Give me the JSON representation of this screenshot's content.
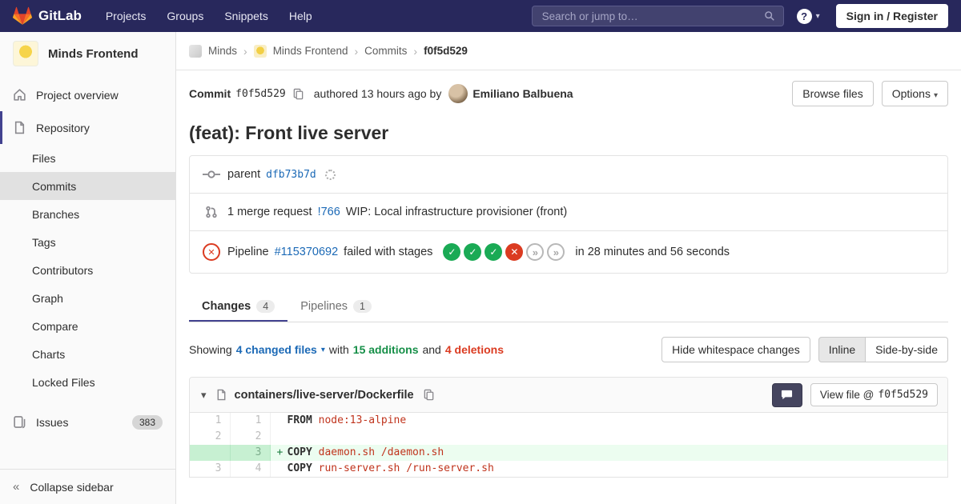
{
  "navbar": {
    "brand": "GitLab",
    "menu": [
      "Projects",
      "Groups",
      "Snippets",
      "Help"
    ],
    "search_placeholder": "Search or jump to…",
    "sign_in_label": "Sign in / Register",
    "help_label": "?"
  },
  "icons": {
    "caret_down": "▾",
    "chevron_right": "›",
    "collapse": "«",
    "check": "✓",
    "cross": "✕",
    "skipped": "»"
  },
  "sidebar": {
    "project_name": "Minds Frontend",
    "overview_label": "Project overview",
    "repository_label": "Repository",
    "repo_items": [
      "Files",
      "Commits",
      "Branches",
      "Tags",
      "Contributors",
      "Graph",
      "Compare",
      "Charts",
      "Locked Files"
    ],
    "issues_label": "Issues",
    "issues_count": "383",
    "collapse_label": "Collapse sidebar"
  },
  "breadcrumb": {
    "minds": "Minds",
    "minds_frontend": "Minds Frontend",
    "commits": "Commits",
    "sha": "f0f5d529"
  },
  "commit": {
    "label": "Commit",
    "sha": "f0f5d529",
    "authored_text": "authored 13 hours ago by",
    "author": "Emiliano Balbuena",
    "browse_files_label": "Browse files",
    "options_label": "Options",
    "title": "(feat): Front live server"
  },
  "parent_row": {
    "label": "parent",
    "sha": "dfb73b7d"
  },
  "merge_request_row": {
    "prefix": "1 merge request",
    "link": "!766",
    "title": "WIP: Local infrastructure provisioner (front)"
  },
  "pipeline_row": {
    "prefix": "Pipeline",
    "link": "#115370692",
    "middle": "failed with stages",
    "suffix": "in 28 minutes and 56 seconds",
    "stages": [
      "passed",
      "passed",
      "passed",
      "failed",
      "skipped",
      "skipped"
    ]
  },
  "tabs": {
    "changes_label": "Changes",
    "changes_count": "4",
    "pipelines_label": "Pipelines",
    "pipelines_count": "1"
  },
  "summary": {
    "showing": "Showing",
    "changed_files": "4 changed files",
    "with_text": "with",
    "additions": "15 additions",
    "and_text": "and",
    "deletions": "4 deletions",
    "hide_whitespace_label": "Hide whitespace changes",
    "inline_label": "Inline",
    "side_by_side_label": "Side-by-side"
  },
  "diff_file": {
    "path": "containers/live-server/Dockerfile",
    "view_file_label": "View file @",
    "view_file_sha": "f0f5d529",
    "rows": [
      {
        "old": "1",
        "new": "1",
        "sign": "",
        "keyword": "FROM",
        "code": "node:13-alpine",
        "added": false
      },
      {
        "old": "2",
        "new": "2",
        "sign": "",
        "keyword": "",
        "code": "",
        "added": false
      },
      {
        "old": "",
        "new": "3",
        "sign": "+",
        "keyword": "COPY",
        "code": "daemon.sh /daemon.sh",
        "added": true
      },
      {
        "old": "3",
        "new": "4",
        "sign": "",
        "keyword": "COPY",
        "code": "run-server.sh /run-server.sh",
        "added": false
      }
    ]
  },
  "colors": {
    "navbar_bg": "#28285c",
    "accent_indigo": "#42428f",
    "link_blue": "#1b69b6",
    "success_green": "#1aaa55",
    "danger_red": "#db3b21",
    "additions_green": "#168f48",
    "added_line_bg": "#ecfdf0",
    "sidebar_active_bg": "#e1e1e1"
  }
}
